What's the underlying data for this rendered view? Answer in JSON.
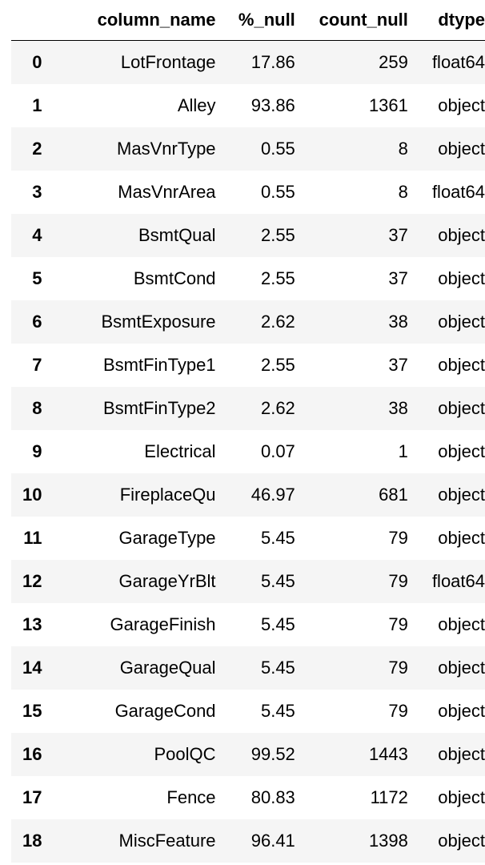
{
  "table": {
    "columns": [
      "",
      "column_name",
      "%_null",
      "count_null",
      "dtype"
    ],
    "rows": [
      {
        "index": "0",
        "column_name": "LotFrontage",
        "pct_null": "17.86",
        "count_null": "259",
        "dtype": "float64"
      },
      {
        "index": "1",
        "column_name": "Alley",
        "pct_null": "93.86",
        "count_null": "1361",
        "dtype": "object"
      },
      {
        "index": "2",
        "column_name": "MasVnrType",
        "pct_null": "0.55",
        "count_null": "8",
        "dtype": "object"
      },
      {
        "index": "3",
        "column_name": "MasVnrArea",
        "pct_null": "0.55",
        "count_null": "8",
        "dtype": "float64"
      },
      {
        "index": "4",
        "column_name": "BsmtQual",
        "pct_null": "2.55",
        "count_null": "37",
        "dtype": "object"
      },
      {
        "index": "5",
        "column_name": "BsmtCond",
        "pct_null": "2.55",
        "count_null": "37",
        "dtype": "object"
      },
      {
        "index": "6",
        "column_name": "BsmtExposure",
        "pct_null": "2.62",
        "count_null": "38",
        "dtype": "object"
      },
      {
        "index": "7",
        "column_name": "BsmtFinType1",
        "pct_null": "2.55",
        "count_null": "37",
        "dtype": "object"
      },
      {
        "index": "8",
        "column_name": "BsmtFinType2",
        "pct_null": "2.62",
        "count_null": "38",
        "dtype": "object"
      },
      {
        "index": "9",
        "column_name": "Electrical",
        "pct_null": "0.07",
        "count_null": "1",
        "dtype": "object"
      },
      {
        "index": "10",
        "column_name": "FireplaceQu",
        "pct_null": "46.97",
        "count_null": "681",
        "dtype": "object"
      },
      {
        "index": "11",
        "column_name": "GarageType",
        "pct_null": "5.45",
        "count_null": "79",
        "dtype": "object"
      },
      {
        "index": "12",
        "column_name": "GarageYrBlt",
        "pct_null": "5.45",
        "count_null": "79",
        "dtype": "float64"
      },
      {
        "index": "13",
        "column_name": "GarageFinish",
        "pct_null": "5.45",
        "count_null": "79",
        "dtype": "object"
      },
      {
        "index": "14",
        "column_name": "GarageQual",
        "pct_null": "5.45",
        "count_null": "79",
        "dtype": "object"
      },
      {
        "index": "15",
        "column_name": "GarageCond",
        "pct_null": "5.45",
        "count_null": "79",
        "dtype": "object"
      },
      {
        "index": "16",
        "column_name": "PoolQC",
        "pct_null": "99.52",
        "count_null": "1443",
        "dtype": "object"
      },
      {
        "index": "17",
        "column_name": "Fence",
        "pct_null": "80.83",
        "count_null": "1172",
        "dtype": "object"
      },
      {
        "index": "18",
        "column_name": "MiscFeature",
        "pct_null": "96.41",
        "count_null": "1398",
        "dtype": "object"
      }
    ]
  },
  "colors": {
    "stripe": "#f5f5f5",
    "background": "#ffffff",
    "text": "#000000"
  }
}
